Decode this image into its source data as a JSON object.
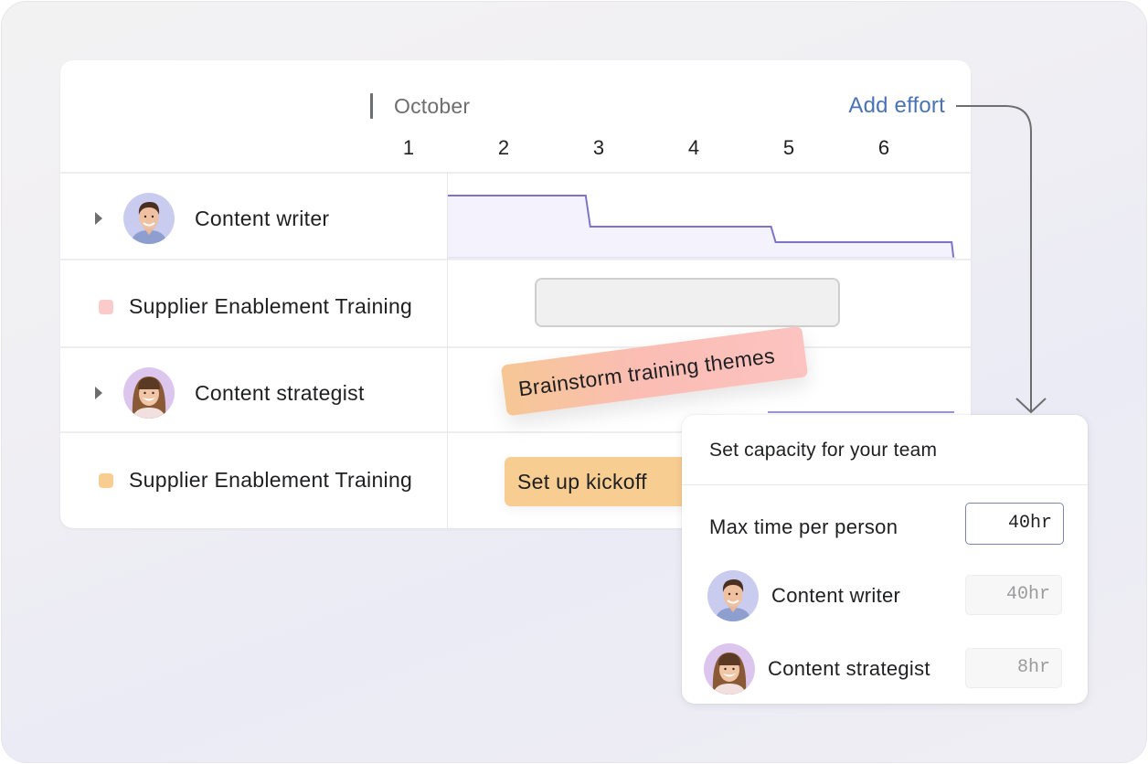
{
  "header": {
    "month": "October",
    "add_effort_label": "Add effort",
    "days": [
      "1",
      "2",
      "3",
      "4",
      "5",
      "6"
    ]
  },
  "rows": [
    {
      "type": "person",
      "label": "Content writer",
      "avatar": "man-avatar",
      "expanded": false
    },
    {
      "type": "project",
      "label": "Supplier Enablement Training",
      "swatch_color": "#fbcaca"
    },
    {
      "type": "person",
      "label": "Content strategist",
      "avatar": "woman-avatar",
      "expanded": false
    },
    {
      "type": "project",
      "label": "Supplier Enablement Training",
      "swatch_color": "#f7cd92"
    }
  ],
  "capacity_chart": {
    "line_color": "#7d74c8",
    "fill_color": "#f4f2fd",
    "steps": [
      {
        "from_day": 1,
        "to_day": 2.45,
        "level": 0.8
      },
      {
        "from_day": 2.45,
        "to_day": 4.4,
        "level": 0.4
      },
      {
        "from_day": 4.4,
        "to_day": 6.3,
        "level": 0.2
      }
    ]
  },
  "tasks": {
    "brainstorm": {
      "label": "Brainstorm training themes",
      "state": "dragging"
    },
    "kickoff": {
      "label": "Set up kickoff",
      "color": "#f7cd92"
    }
  },
  "popover": {
    "title": "Set capacity for your team",
    "max_time_label": "Max time per person",
    "max_time_value": "40hr",
    "people": [
      {
        "name": "Content writer",
        "hours": "40hr",
        "avatar": "man-avatar"
      },
      {
        "name": "Content strategist",
        "hours": "8hr",
        "avatar": "woman-avatar"
      }
    ]
  },
  "colors": {
    "accent_link": "#4a73b5",
    "text_primary": "#1e1f21",
    "text_secondary": "#6d6e6f"
  }
}
